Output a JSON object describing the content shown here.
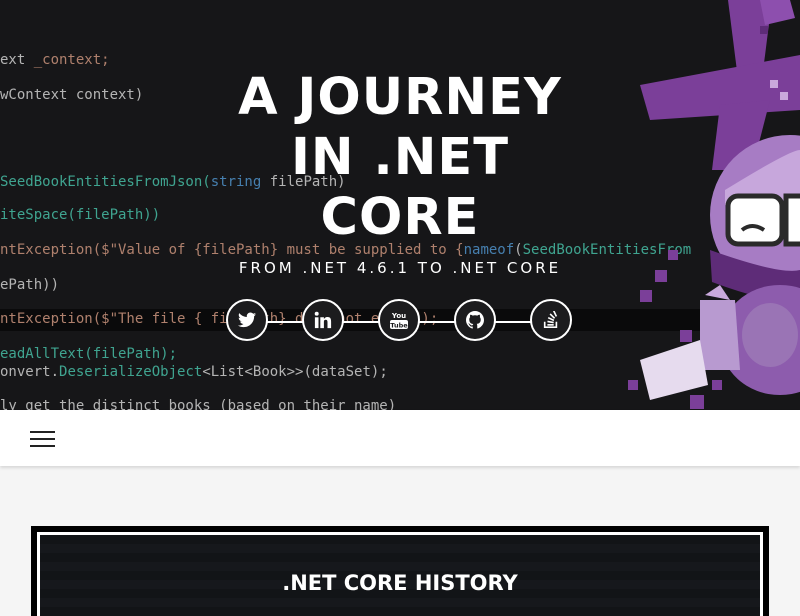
{
  "hero": {
    "title_line1": "A JOURNEY",
    "title_line2": "IN .NET",
    "title_line3": "CORE",
    "subtitle": "FROM .NET 4.6.1 TO .NET CORE",
    "code_lines": [
      [
        "ext ",
        "_context;"
      ],
      [
        "wContext context)"
      ],
      [
        "SeedBookEntitiesFromJson(",
        "string",
        " filePath)"
      ],
      [
        "iteSpace(filePath))"
      ],
      [
        "ntException($\"Value of {filePath} must be supplied to {",
        "nameof",
        "(",
        "SeedBookEntitiesFrom"
      ],
      [
        "ePath))"
      ],
      [
        "ntException($\"The file { filePath} does not exist\");"
      ],
      [
        "eadAllText(filePath);"
      ],
      [
        "onvert.",
        "DeserializeObject",
        "<List<Book>>(dataSet);"
      ],
      [
        "ly get the distinct books (based on their name)"
      ]
    ]
  },
  "social": [
    {
      "name": "twitter",
      "icon": "twitter-icon"
    },
    {
      "name": "linkedin",
      "icon": "linkedin-icon"
    },
    {
      "name": "youtube",
      "icon": "youtube-icon"
    },
    {
      "name": "github",
      "icon": "github-icon"
    },
    {
      "name": "stackoverflow",
      "icon": "stackoverflow-icon"
    }
  ],
  "nav": {
    "menu_icon": "hamburger-menu-icon"
  },
  "card": {
    "title": ".NET CORE HISTORY"
  },
  "colors": {
    "mascot_purple": "#7b3f99",
    "hero_bg": "#1c1c1e",
    "page_bg": "#f5f5f5"
  }
}
